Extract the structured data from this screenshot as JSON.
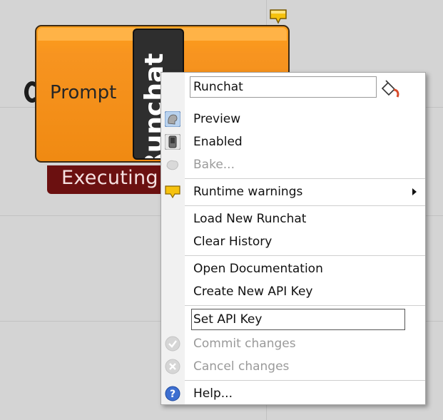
{
  "canvas": {
    "background": "#d4d4d4",
    "grid_color": "#c2c2c2"
  },
  "component": {
    "prompt_label": "Prompt",
    "name": "Runchat",
    "status": "Executing",
    "body_color": "#f79420",
    "status_color": "#6b1010"
  },
  "menu": {
    "name_field_value": "Runchat",
    "items": [
      {
        "label": "Preview",
        "icon": "preview-icon",
        "enabled": true
      },
      {
        "label": "Enabled",
        "icon": "enabled-icon",
        "enabled": true
      },
      {
        "label": "Bake...",
        "icon": "bake-icon",
        "enabled": false
      },
      {
        "label": "Runtime warnings",
        "icon": "warning-bubble-icon",
        "enabled": true,
        "submenu": true
      },
      {
        "label": "Load New Runchat",
        "enabled": true
      },
      {
        "label": "Clear History",
        "enabled": true
      },
      {
        "label": "Open Documentation",
        "enabled": true
      },
      {
        "label": "Create New API Key",
        "enabled": true
      },
      {
        "label": "Commit changes",
        "icon": "check-icon",
        "enabled": false
      },
      {
        "label": "Cancel changes",
        "icon": "cancel-icon",
        "enabled": false
      },
      {
        "label": "Help...",
        "icon": "help-icon",
        "enabled": true
      }
    ],
    "api_key_field_value": "Set API Key"
  }
}
